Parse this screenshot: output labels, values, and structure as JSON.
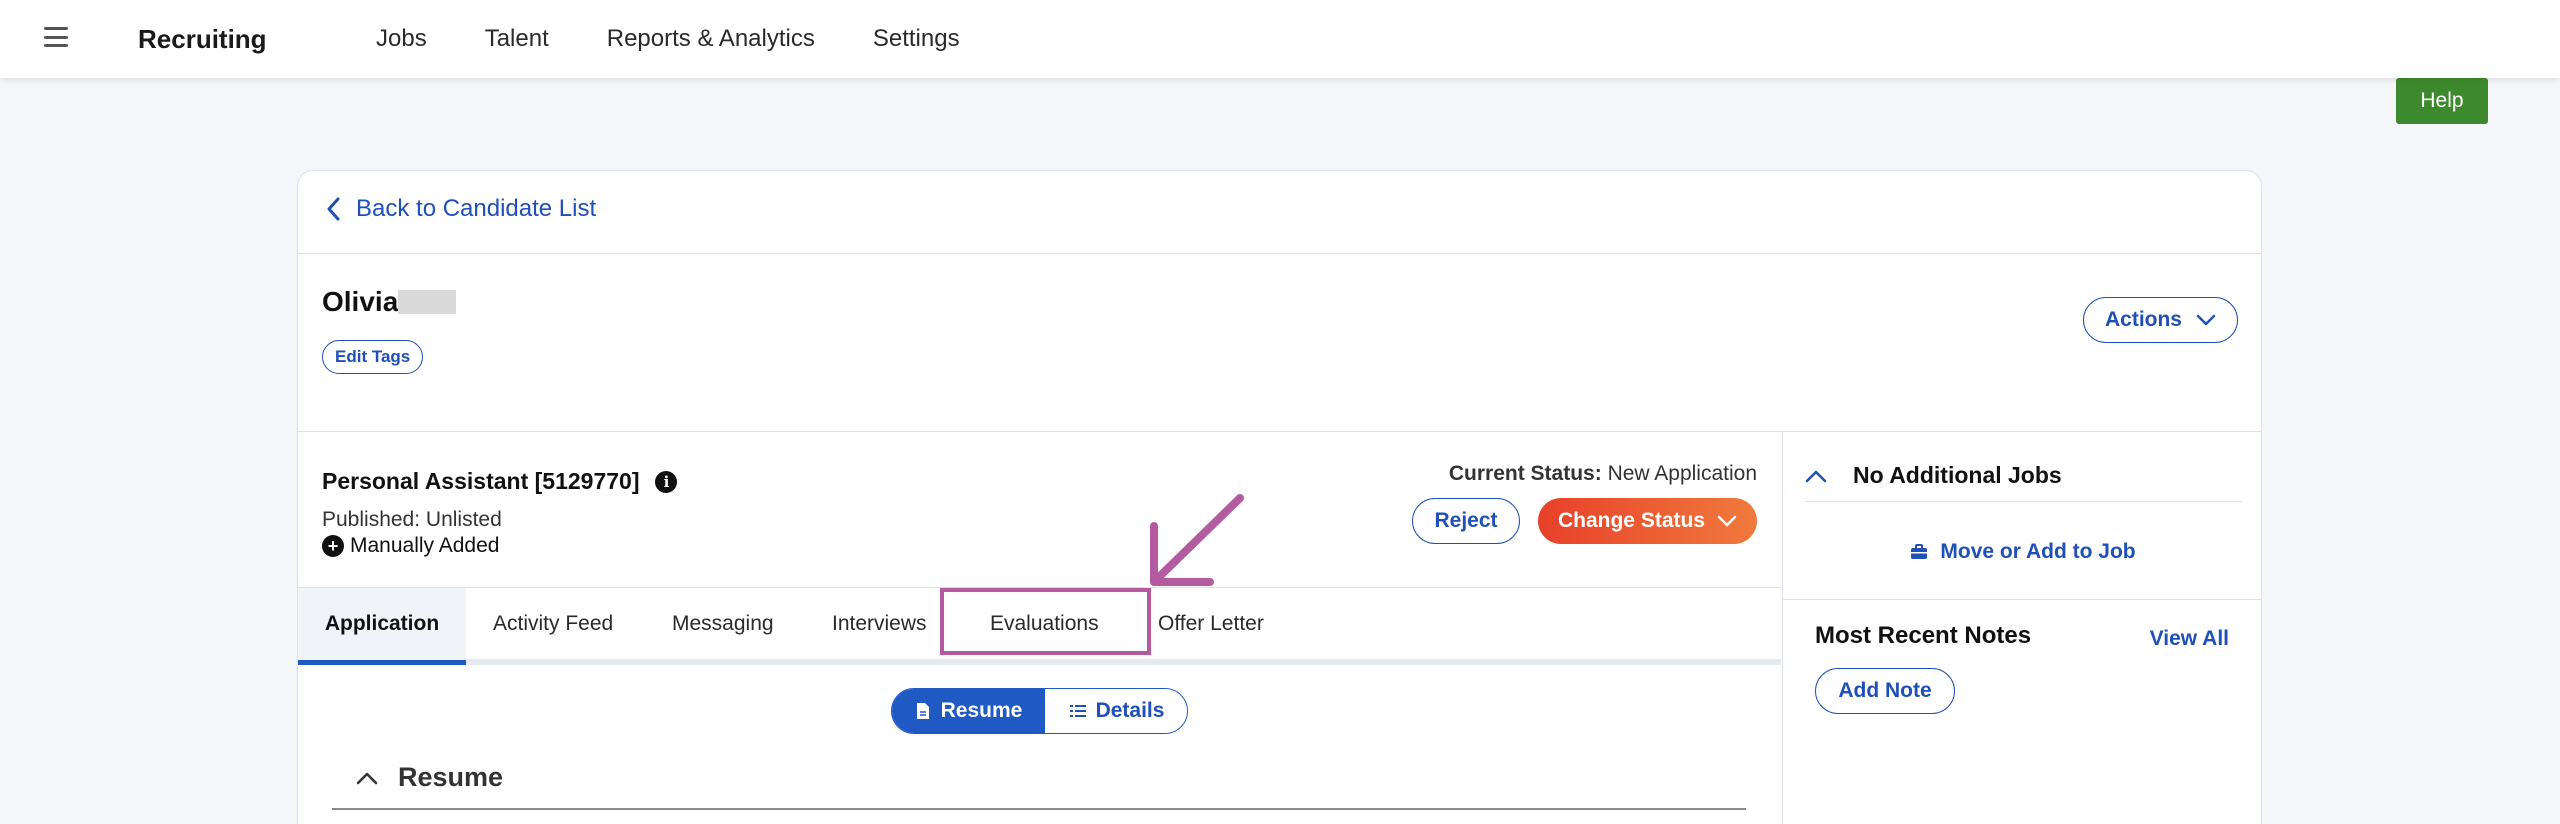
{
  "topbar": {
    "app_title": "Recruiting",
    "nav": [
      "Jobs",
      "Talent",
      "Reports & Analytics",
      "Settings"
    ]
  },
  "help_label": "Help",
  "back_label": "Back to Candidate List",
  "candidate": {
    "first_name": "Olivia",
    "edit_tags_label": "Edit Tags",
    "actions_label": "Actions"
  },
  "job": {
    "title": "Personal Assistant [5129770]",
    "published": "Published: Unlisted",
    "source": "Manually Added",
    "status_label": "Current Status:",
    "status_value": "New Application",
    "reject_label": "Reject",
    "change_status_label": "Change Status"
  },
  "tabs": [
    {
      "label": "Application"
    },
    {
      "label": "Activity Feed"
    },
    {
      "label": "Messaging"
    },
    {
      "label": "Interviews"
    },
    {
      "label": "Evaluations"
    },
    {
      "label": "Offer Letter"
    }
  ],
  "view_toggle": {
    "resume_label": "Resume",
    "details_label": "Details"
  },
  "section_title": "Resume",
  "sidebar": {
    "jobs_title": "No Additional Jobs",
    "move_label": "Move or Add to Job",
    "notes_title": "Most Recent Notes",
    "view_all_label": "View All",
    "add_note_label": "Add Note"
  },
  "colors": {
    "primary": "#1f4fb8",
    "help_green": "#3d8a2e",
    "change_status_from": "#e8402a",
    "change_status_to": "#f07a3c",
    "annotation": "#b45aa0"
  }
}
